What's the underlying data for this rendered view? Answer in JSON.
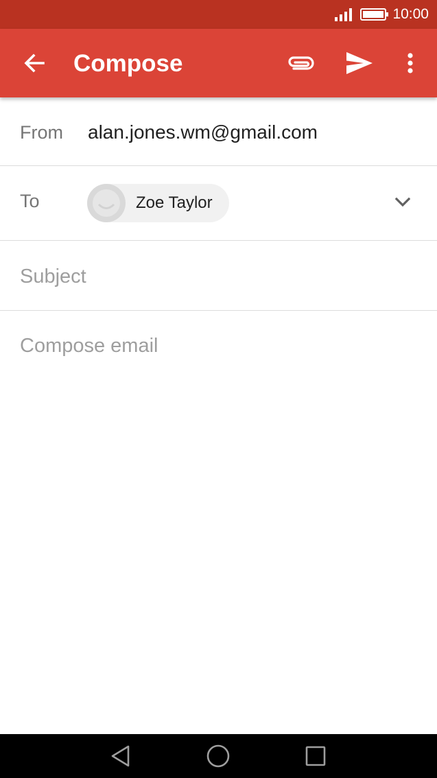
{
  "status_bar": {
    "time": "10:00",
    "icons": [
      "signal-icon",
      "battery-icon"
    ]
  },
  "app_bar": {
    "title": "Compose",
    "icons": [
      "arrow-back-icon",
      "paperclip-icon",
      "send-icon",
      "more-vert-icon"
    ]
  },
  "from": {
    "label": "From",
    "value": "alan.jones.wm@gmail.com"
  },
  "to": {
    "label": "To",
    "recipients": [
      {
        "name": "Zoe Taylor",
        "avatar_icon": "default-avatar-icon"
      }
    ],
    "expand_icon": "chevron-down-icon"
  },
  "subject": {
    "value": "",
    "placeholder": "Subject"
  },
  "body": {
    "value": "",
    "placeholder": "Compose email"
  },
  "nav_bar": {
    "icons": [
      "nav-back-icon",
      "nav-home-icon",
      "nav-recents-icon"
    ]
  },
  "colors": {
    "status_bar": "#b93221",
    "app_bar": "#db4437",
    "chip_background": "#f1f1f1",
    "divider": "#dcdcdc",
    "label_text": "#757575",
    "placeholder_text": "#9e9e9e",
    "primary_text": "#212121",
    "nav_bar": "#000000"
  }
}
